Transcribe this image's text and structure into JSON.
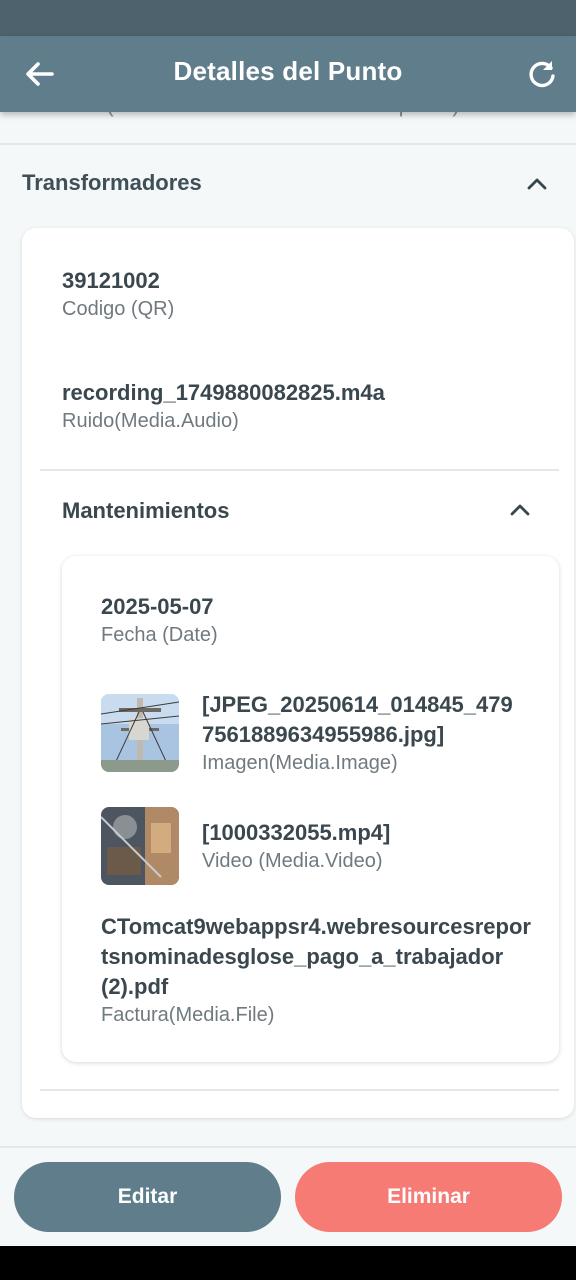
{
  "app_bar": {
    "title": "Detalles del Punto"
  },
  "partial_field": "Material (StaticSelection - Material del poste)",
  "transformadores": {
    "header": "Transformadores",
    "fields": [
      {
        "value": "39121002",
        "label": "Codigo (QR)"
      },
      {
        "value": "recording_1749880082825.m4a",
        "label": "Ruido(Media.Audio)"
      }
    ],
    "mantenimientos": {
      "header": "Mantenimientos",
      "date": {
        "value": "2025-05-07",
        "label": "Fecha (Date)"
      },
      "image": {
        "value": "[JPEG_20250614_014845_4797561889634955986.jpg]",
        "label": "Imagen(Media.Image)"
      },
      "video": {
        "value": "[1000332055.mp4]",
        "label": "Video (Media.Video)"
      },
      "file": {
        "value": "CTomcat9webappsr4.webresourcesreportsnominadesglose_pago_a_trabajador (2).pdf",
        "label": "Factura(Media.File)"
      }
    }
  },
  "actions": {
    "edit": "Editar",
    "delete": "Eliminar"
  },
  "icons": [
    "arrow-back-icon",
    "refresh-icon",
    "chevron-up-icon"
  ],
  "colors": {
    "primary": "#607d8b",
    "danger": "#f57b74",
    "status_bar": "#4d626c"
  }
}
